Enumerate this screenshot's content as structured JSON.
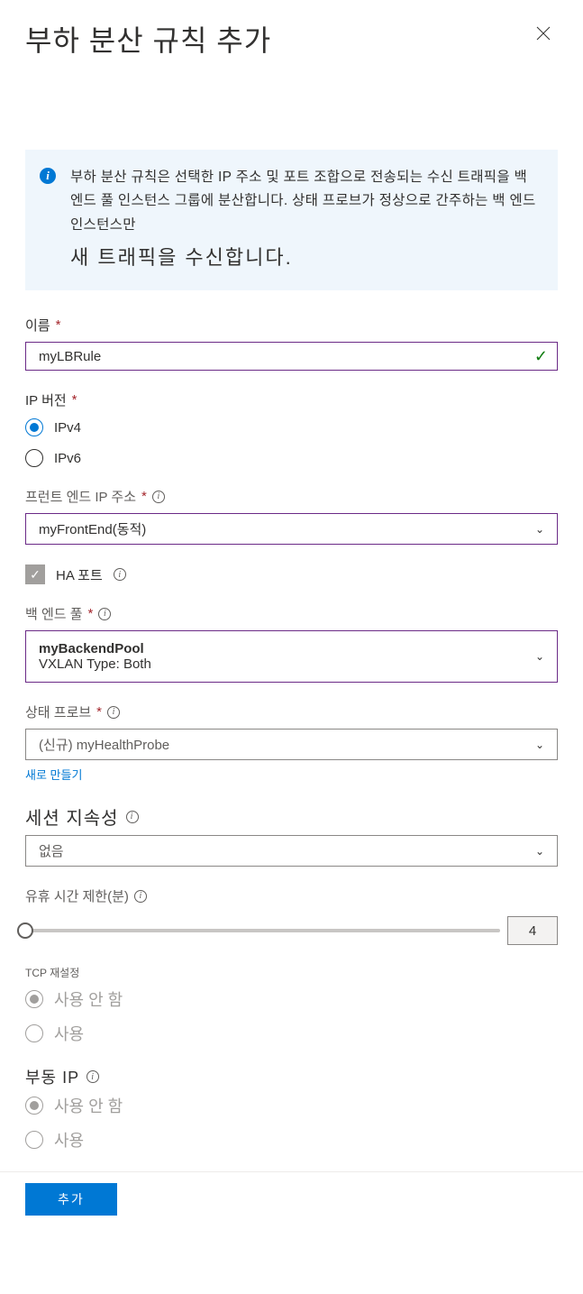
{
  "header": {
    "title": "부하 분산 규칙 추가"
  },
  "info": {
    "line1": "부하 분산 규칙은 선택한 IP 주소 및 포트 조합으로 전송되는 수신 트래픽을 백 엔드 풀 인스턴스 그룹에 분산합니다. 상태 프로브가 정상으로 간주하는 백 엔드 인스턴스만",
    "line2": "새 트래픽을 수신합니다."
  },
  "name": {
    "label": "이름",
    "value": "myLBRule"
  },
  "ipversion": {
    "label": "IP 버전",
    "opt1": "IPv4",
    "opt2": "IPv6"
  },
  "frontend": {
    "label": "프런트 엔드 IP 주소",
    "value": "myFrontEnd(동적)"
  },
  "haports": {
    "label": "HA 포트"
  },
  "backend": {
    "label": "백 엔드 풀",
    "value": "myBackendPool",
    "subtitle": "VXLAN Type: Both"
  },
  "probe": {
    "label": "상태 프로브",
    "value": "(신규) myHealthProbe",
    "link": "새로 만들기"
  },
  "session": {
    "label": "세션 지속성",
    "value": "없음"
  },
  "idle": {
    "label": "유휴 시간 제한(분)",
    "value": "4"
  },
  "tcpreset": {
    "label": "TCP 재설정",
    "opt1": "사용 안 함",
    "opt2": "사용"
  },
  "floatingip": {
    "label": "부동 IP",
    "opt1": "사용 안 함",
    "opt2": "사용"
  },
  "footer": {
    "add": "추가"
  }
}
